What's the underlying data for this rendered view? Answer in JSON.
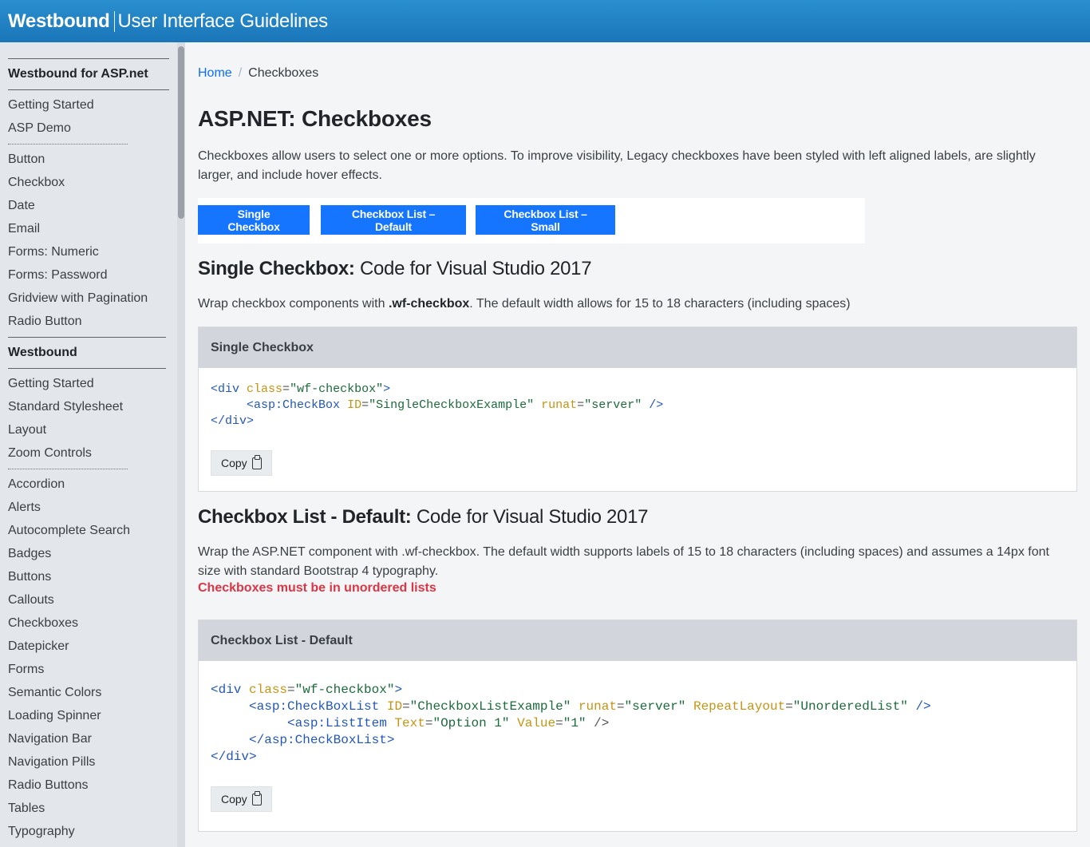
{
  "header": {
    "brand": "Westbound",
    "subtitle": "User Interface Guidelines"
  },
  "sidebar": {
    "section1_title": "Westbound for ASP.net",
    "group1": [
      "Getting Started",
      "ASP Demo"
    ],
    "group2": [
      "Button",
      "Checkbox",
      "Date",
      "Email",
      "Forms: Numeric",
      "Forms: Password",
      "Gridview with Pagination",
      "Radio Button"
    ],
    "section2_title": "Westbound",
    "group3": [
      "Getting Started",
      "Standard Stylesheet",
      "Layout",
      "Zoom Controls"
    ],
    "group4": [
      "Accordion",
      "Alerts",
      "Autocomplete Search",
      "Badges",
      "Buttons",
      "Callouts",
      "Checkboxes",
      "Datepicker",
      "Forms",
      "Semantic Colors",
      "Loading Spinner",
      "Navigation Bar",
      "Navigation Pills",
      "Radio Buttons",
      "Tables",
      "Typography"
    ]
  },
  "breadcrumb": {
    "home": "Home",
    "separator": "/",
    "current": "Checkboxes"
  },
  "page": {
    "title": "ASP.NET: Checkboxes",
    "intro": "Checkboxes allow users to select one or more options. To improve visibility, Legacy checkboxes have been styled with left aligned labels, are slightly larger, and include hover effects."
  },
  "tabs": [
    "Single Checkbox",
    "Checkbox List – Default",
    "Checkbox List – Small"
  ],
  "section1": {
    "heading_bold": "Single Checkbox:",
    "heading_rest": " Code for Visual Studio 2017",
    "desc_pre": "Wrap checkbox components with ",
    "desc_bold": ".wf-checkbox",
    "desc_post": ". The default width allows for 15 to 18 characters (including spaces)",
    "card_title": "Single Checkbox",
    "copy_label": "Copy"
  },
  "section2": {
    "heading_bold": "Checkbox List - Default:",
    "heading_rest": " Code for Visual Studio 2017",
    "desc": "Wrap the ASP.NET component with .wf-checkbox. The default width supports labels of 15 to 18 characters (including spaces) and assumes a 14px font size with standard Bootstrap 4 typography.",
    "warning": "Checkboxes must be in unordered lists",
    "card_title": "Checkbox List - Default",
    "copy_label": "Copy"
  },
  "colors": {
    "header_bg": "#1a76b8",
    "button_blue": "#1575ff",
    "warning_red": "#dc3545",
    "link_blue": "#0d6efd"
  },
  "icons": {
    "copy": "clipboard-icon"
  }
}
